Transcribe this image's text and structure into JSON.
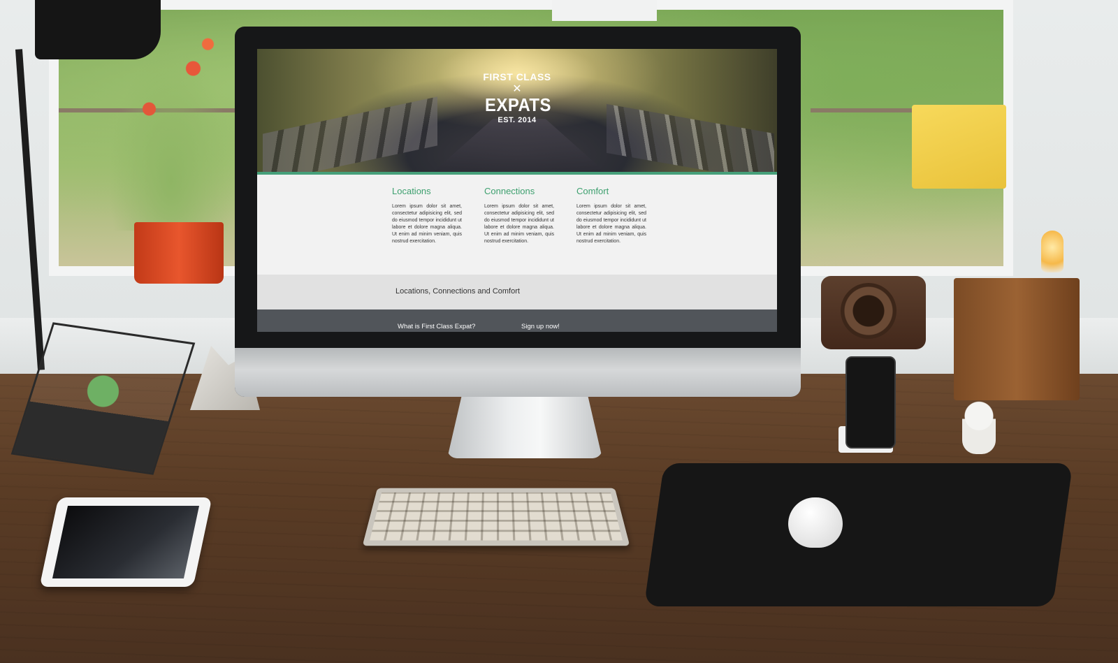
{
  "site": {
    "logo": {
      "top_text": "FIRST CLASS",
      "main_text": "EXPATS",
      "est_text": "EST. 2014"
    },
    "features": [
      {
        "title": "Locations",
        "text": "Lorem ipsum dolor sit amet, consectetur adipisicing elit, sed do eiusmod tempor incididunt ut labore et dolore magna aliqua. Ut enim ad minim veniam, quis nostrud exercitation."
      },
      {
        "title": "Connections",
        "text": "Lorem ipsum dolor sit amet, consectetur adipisicing elit, sed do eiusmod tempor incididunt ut labore et dolore magna aliqua. Ut enim ad minim veniam, quis nostrud exercitation."
      },
      {
        "title": "Comfort",
        "text": "Lorem ipsum dolor sit amet, consectetur adipisicing elit, sed do eiusmod tempor incididunt ut labore et dolore magna aliqua. Ut enim ad minim veniam, quis nostrud exercitation."
      }
    ],
    "tagline": "Locations, Connections and Comfort",
    "nav": [
      {
        "label": "What is First Class Expat?"
      },
      {
        "label": "Sign up now!"
      }
    ]
  },
  "colors": {
    "accent_green": "#3ea06f",
    "footer_gray": "#51555a",
    "band_gray": "#e1e1e1"
  }
}
